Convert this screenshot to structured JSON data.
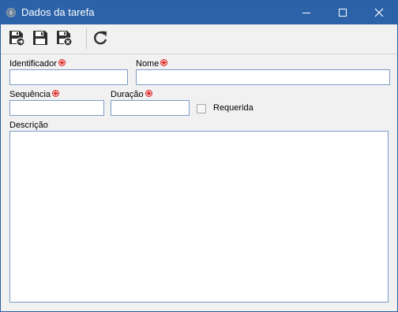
{
  "window": {
    "title": "Dados da tarefa",
    "icon": "app-globe-icon",
    "controls": [
      "minimize-icon",
      "maximize-icon",
      "close-icon"
    ]
  },
  "toolbar": {
    "buttons": [
      {
        "name": "save-new",
        "icon": "save-new-icon"
      },
      {
        "name": "save",
        "icon": "save-icon"
      },
      {
        "name": "save-close",
        "icon": "save-close-icon"
      },
      {
        "name": "refresh",
        "icon": "refresh-icon"
      }
    ]
  },
  "form": {
    "identifier": {
      "label": "Identificador",
      "value": "",
      "required": true
    },
    "name": {
      "label": "Nome",
      "value": "",
      "required": true
    },
    "sequence": {
      "label": "Sequência",
      "value": "",
      "required": true
    },
    "duration": {
      "label": "Duração",
      "value": "",
      "required": true
    },
    "required_check": {
      "label": "Requerida",
      "checked": false
    },
    "description": {
      "label": "Descrição",
      "value": ""
    }
  },
  "colors": {
    "titlebar": "#2b62a8",
    "required_marker": "#e02020",
    "input_border": "#7a9cc6",
    "panel_background": "#f1f1f1"
  }
}
